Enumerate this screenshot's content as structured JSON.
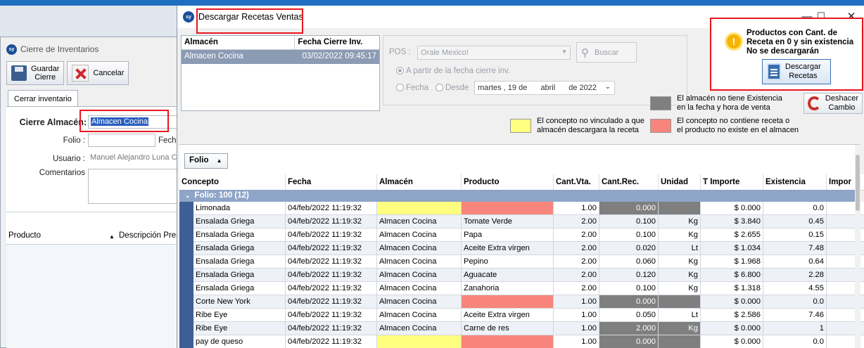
{
  "background_window": {
    "title": "Cierre de Inventarios",
    "save_label_1": "Guardar",
    "save_label_2": "Cierre",
    "cancel_label": "Cancelar",
    "tab_label": "Cerrar inventario",
    "cierre_almacen_label": "Cierre Almacén:",
    "cierre_almacen_value": "Almacen Cocina",
    "folio_label": "Folio :",
    "fecha_label": "Fecha",
    "usuario_label": "Usuario :",
    "usuario_value": "Manuel Alejandro  Luna Ce",
    "comentarios_label": "Comentarios",
    "grid_col_producto": "Producto",
    "grid_col_descripcion": "Descripción Pres"
  },
  "dialog": {
    "title": "Descargar Recetas Ventas",
    "almacen_table": {
      "headers": [
        "Almacén",
        "Fecha Cierre Inv."
      ],
      "row": [
        "Almacen Cocina",
        "03/02/2022 09:45:17"
      ]
    },
    "pos_label": "POS :",
    "pos_value": "Orale Mexico!",
    "buscar_label": "Buscar",
    "option_fecha_cierre": "A partir de la fecha cierre inv.",
    "option_fecha": "Fecha",
    "option_desde": "Desde",
    "date_day": "martes , 19 de",
    "date_month": "abril",
    "date_year": "de 2022",
    "warning_text": "Productos con Cant. de Receta en 0 y sin existencia No se descargarán",
    "descargar_label_1": "Descargar",
    "descargar_label_2": "Recetas",
    "deshacer_label_1": "Deshacer",
    "deshacer_label_2": "Cambio",
    "legend_gray_1": "El almacén no tiene Existencia",
    "legend_gray_2": "en la fecha y hora de venta",
    "legend_yellow_1": "El concepto no vinculado a que",
    "legend_yellow_2": "almacén descargara la receta",
    "legend_red_1": "El concepto no contiene receta o",
    "legend_red_2": "el producto no existe en el almacen",
    "colors": {
      "gray": "#7f7f7f",
      "yellow": "#ffff80",
      "red": "#f8857c"
    }
  },
  "grid": {
    "group_button": "Folio",
    "columns": [
      "Concepto",
      "Fecha",
      "Almacén",
      "Producto",
      "Cant.Vta.",
      "Cant.Rec.",
      "Unidad",
      "T Importe",
      "Existencia",
      "Impor"
    ],
    "group_row": "Folio: 100 (12)",
    "rows": [
      {
        "concepto": "Limonada",
        "fecha": "04/feb/2022 11:19:32",
        "almacen": "",
        "producto": "",
        "cant_vta": "1.00",
        "cant_rec": "0.000",
        "unidad": "",
        "importe": "$ 0.000",
        "existencia": "0.0",
        "almacen_style": "yellow",
        "producto_style": "salmon",
        "rec_style": "dark",
        "unidad_style": "dark"
      },
      {
        "concepto": "Ensalada Griega",
        "fecha": "04/feb/2022 11:19:32",
        "almacen": "Almacen Cocina",
        "producto": "Tomate Verde",
        "cant_vta": "2.00",
        "cant_rec": "0.100",
        "unidad": "Kg",
        "importe": "$ 3.840",
        "existencia": "0.45",
        "almacen_style": "",
        "producto_style": "",
        "rec_style": "",
        "unidad_style": ""
      },
      {
        "concepto": "Ensalada Griega",
        "fecha": "04/feb/2022 11:19:32",
        "almacen": "Almacen Cocina",
        "producto": "Papa",
        "cant_vta": "2.00",
        "cant_rec": "0.100",
        "unidad": "Kg",
        "importe": "$ 2.655",
        "existencia": "0.15",
        "almacen_style": "",
        "producto_style": "",
        "rec_style": "",
        "unidad_style": ""
      },
      {
        "concepto": "Ensalada Griega",
        "fecha": "04/feb/2022 11:19:32",
        "almacen": "Almacen Cocina",
        "producto": "Aceite Extra virgen",
        "cant_vta": "2.00",
        "cant_rec": "0.020",
        "unidad": "Lt",
        "importe": "$ 1.034",
        "existencia": "7.48",
        "almacen_style": "",
        "producto_style": "",
        "rec_style": "",
        "unidad_style": ""
      },
      {
        "concepto": "Ensalada Griega",
        "fecha": "04/feb/2022 11:19:32",
        "almacen": "Almacen Cocina",
        "producto": "Pepino",
        "cant_vta": "2.00",
        "cant_rec": "0.060",
        "unidad": "Kg",
        "importe": "$ 1.968",
        "existencia": "0.64",
        "almacen_style": "",
        "producto_style": "",
        "rec_style": "",
        "unidad_style": ""
      },
      {
        "concepto": "Ensalada Griega",
        "fecha": "04/feb/2022 11:19:32",
        "almacen": "Almacen Cocina",
        "producto": "Aguacate",
        "cant_vta": "2.00",
        "cant_rec": "0.120",
        "unidad": "Kg",
        "importe": "$ 6.800",
        "existencia": "2.28",
        "almacen_style": "",
        "producto_style": "",
        "rec_style": "",
        "unidad_style": ""
      },
      {
        "concepto": "Ensalada Griega",
        "fecha": "04/feb/2022 11:19:32",
        "almacen": "Almacen Cocina",
        "producto": "Zanahoria",
        "cant_vta": "2.00",
        "cant_rec": "0.100",
        "unidad": "Kg",
        "importe": "$ 1.318",
        "existencia": "4.55",
        "almacen_style": "",
        "producto_style": "",
        "rec_style": "",
        "unidad_style": ""
      },
      {
        "concepto": "Corte New York",
        "fecha": "04/feb/2022 11:19:32",
        "almacen": "Almacen Cocina",
        "producto": "",
        "cant_vta": "1.00",
        "cant_rec": "0.000",
        "unidad": "",
        "importe": "$ 0.000",
        "existencia": "0.0",
        "almacen_style": "",
        "producto_style": "salmon",
        "rec_style": "dark",
        "unidad_style": "dark"
      },
      {
        "concepto": "Ribe Eye",
        "fecha": "04/feb/2022 11:19:32",
        "almacen": "Almacen Cocina",
        "producto": "Aceite Extra virgen",
        "cant_vta": "1.00",
        "cant_rec": "0.050",
        "unidad": "Lt",
        "importe": "$ 2.586",
        "existencia": "7.46",
        "almacen_style": "",
        "producto_style": "",
        "rec_style": "",
        "unidad_style": ""
      },
      {
        "concepto": "Ribe Eye",
        "fecha": "04/feb/2022 11:19:32",
        "almacen": "Almacen Cocina",
        "producto": "Carne de res",
        "cant_vta": "1.00",
        "cant_rec": "2.000",
        "unidad": "Kg",
        "importe": "$ 0.000",
        "existencia": "1",
        "almacen_style": "",
        "producto_style": "",
        "rec_style": "dark",
        "unidad_style": "dark"
      },
      {
        "concepto": "pay de queso",
        "fecha": "04/feb/2022 11:19:32",
        "almacen": "",
        "producto": "",
        "cant_vta": "1.00",
        "cant_rec": "0.000",
        "unidad": "",
        "importe": "$ 0.000",
        "existencia": "0.0",
        "almacen_style": "yellow",
        "producto_style": "salmon",
        "rec_style": "dark",
        "unidad_style": "dark"
      }
    ]
  }
}
